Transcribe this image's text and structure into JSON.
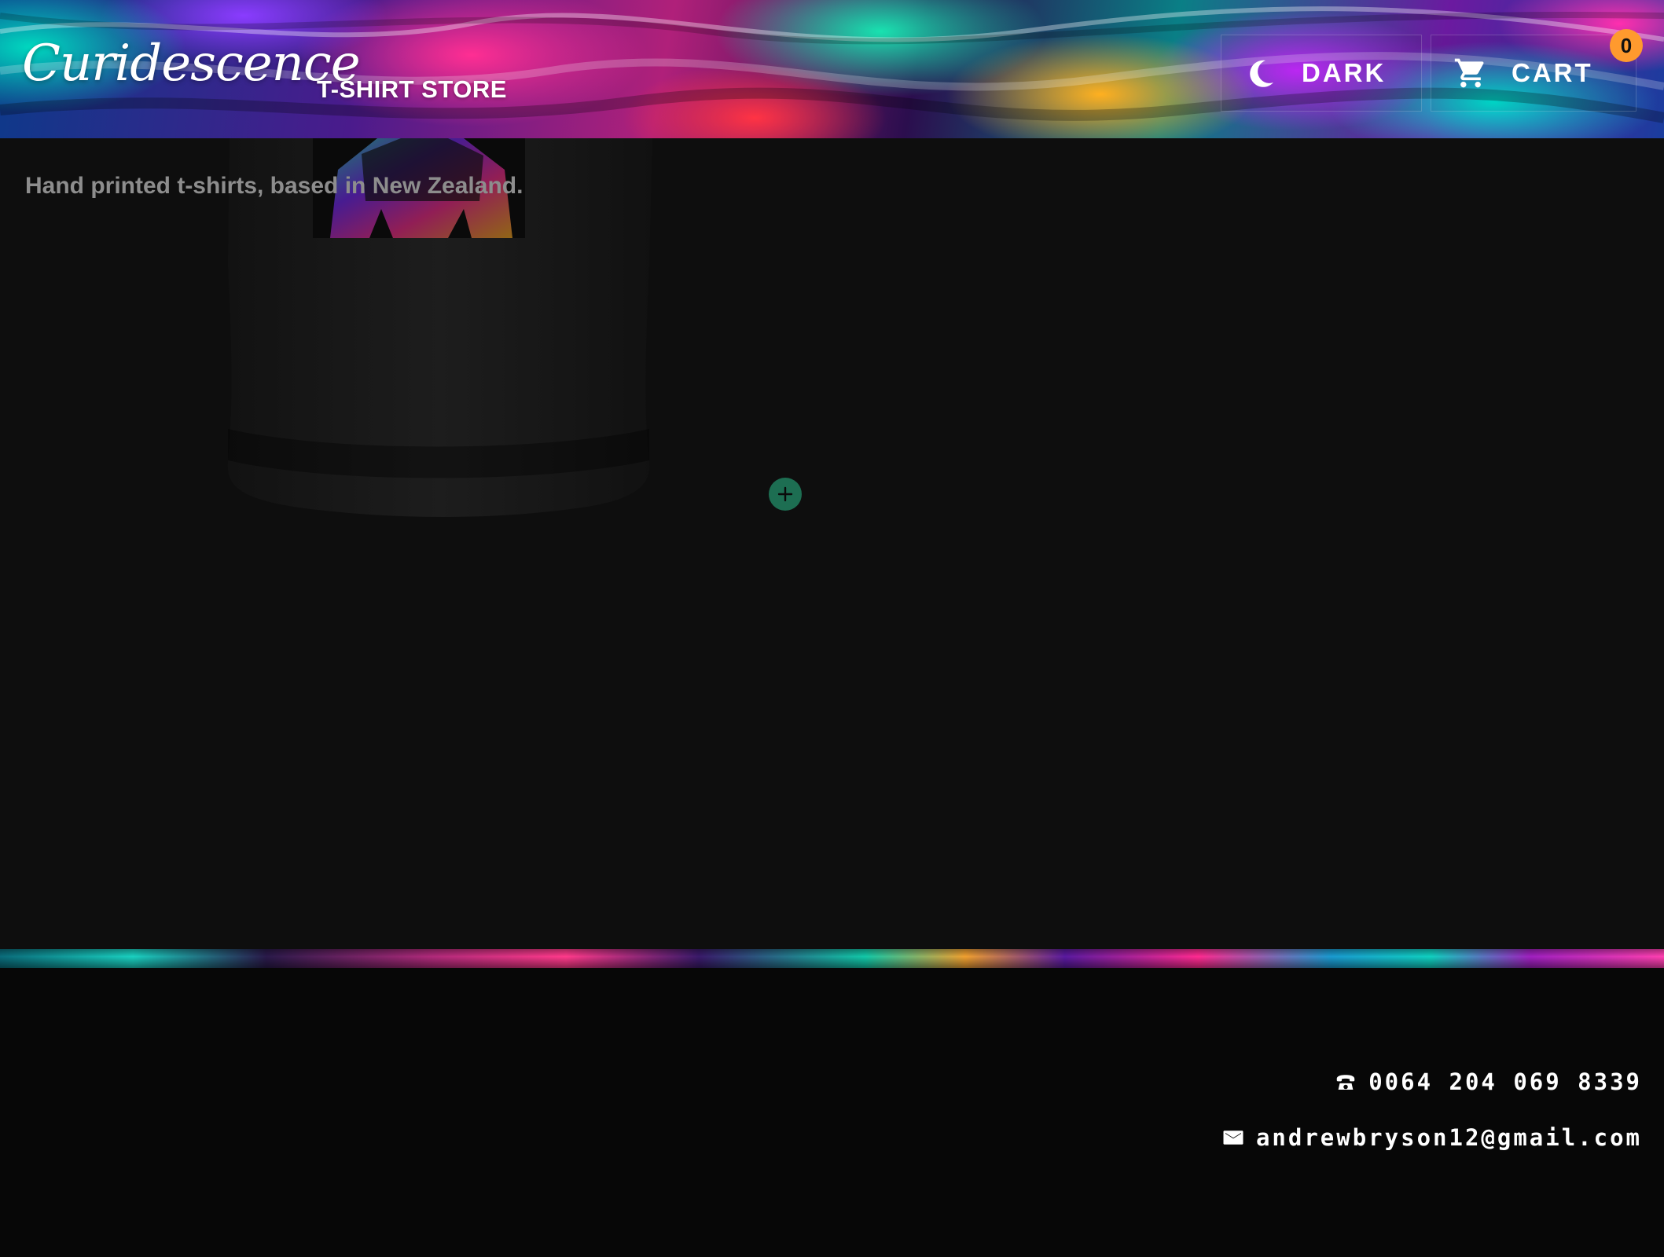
{
  "header": {
    "logo_text": "Curidescence",
    "store_label": "T-SHIRT STORE",
    "theme_button": {
      "label": "DARK",
      "icon": "moon-icon"
    },
    "cart_button": {
      "label": "CART",
      "icon": "cart-icon",
      "count": "0"
    }
  },
  "main": {
    "tagline": "Hand printed t-shirts, based in New Zealand.",
    "add_button_icon": "plus-icon"
  },
  "footer": {
    "phone": {
      "icon": "phone-icon",
      "text": "0064 204 069 8339"
    },
    "email": {
      "icon": "mail-icon",
      "text": "andrewbryson12@gmail.com"
    }
  },
  "colors": {
    "badge": "#ff9a2e",
    "add_button": "#1d6e52",
    "main_bg": "#0e0e0e",
    "footer_bg": "#070707",
    "tagline": "#8d8d8d"
  }
}
